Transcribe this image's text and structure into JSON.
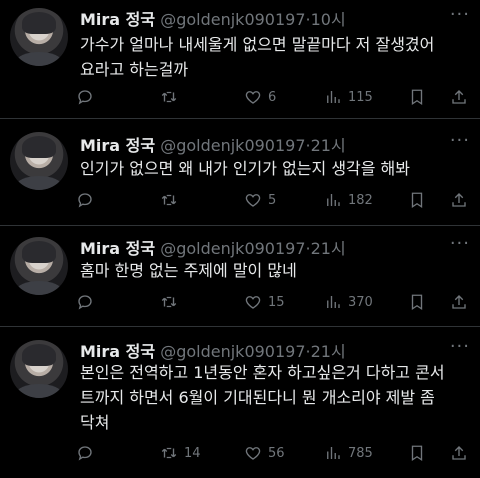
{
  "tweets": [
    {
      "name": "Mira 정국",
      "handle": "@goldenjk090197",
      "time": "·10시",
      "text": "가수가 얼마나 내세울게 없으면 말끝마다 저 잘생겼어\n요라고 하는걸까",
      "reply": "",
      "retweet": "",
      "like": "6",
      "views": "115"
    },
    {
      "name": "Mira 정국",
      "handle": "@goldenjk090197",
      "time": "·21시",
      "text": "인기가 없으면 왜 내가 인기가 없는지 생각을 해봐",
      "reply": "",
      "retweet": "",
      "like": "5",
      "views": "182"
    },
    {
      "name": "Mira 정국",
      "handle": "@goldenjk090197",
      "time": "·21시",
      "text": "홈마 한명 없는 주제에 말이 많네",
      "reply": "",
      "retweet": "",
      "like": "15",
      "views": "370"
    },
    {
      "name": "Mira 정국",
      "handle": "@goldenjk090197",
      "time": "·21시",
      "text": "본인은 전역하고 1년동안 혼자 하고싶은거 다하고 콘서\n트까지 하면서 6월이 기대된다니 뭔 개소리야 제발 좀\n닥쳐",
      "reply": "",
      "retweet": "14",
      "like": "56",
      "views": "785"
    }
  ],
  "more_glyph": "···"
}
